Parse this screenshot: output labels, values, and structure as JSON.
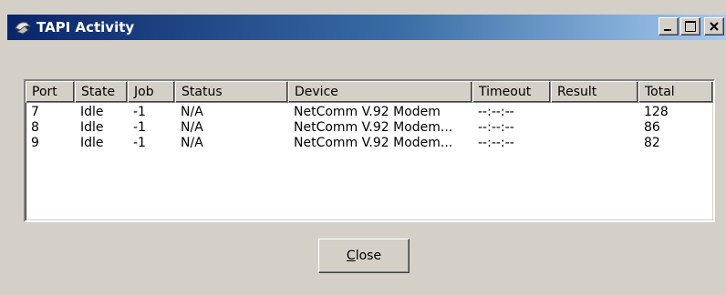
{
  "window": {
    "title": "TAPI Activity",
    "icon": "phone-icon"
  },
  "titlebar_buttons": {
    "minimize": "minimize-icon",
    "maximize": "maximize-icon",
    "close": "close-icon"
  },
  "table": {
    "columns": [
      "Port",
      "State",
      "Job",
      "Status",
      "Device",
      "Timeout",
      "Result",
      "Total"
    ],
    "rows": [
      [
        "7",
        "Idle",
        "-1",
        "N/A",
        "NetComm V.92 Modem",
        "--:--:--",
        "",
        "128"
      ],
      [
        "8",
        "Idle",
        "-1",
        "N/A",
        "NetComm V.92 Modem...",
        "--:--:--",
        "",
        "86"
      ],
      [
        "9",
        "Idle",
        "-1",
        "N/A",
        "NetComm V.92 Modem...",
        "--:--:--",
        "",
        "82"
      ]
    ]
  },
  "buttons": {
    "close_label_mnemonic": "C",
    "close_label_rest": "lose"
  }
}
